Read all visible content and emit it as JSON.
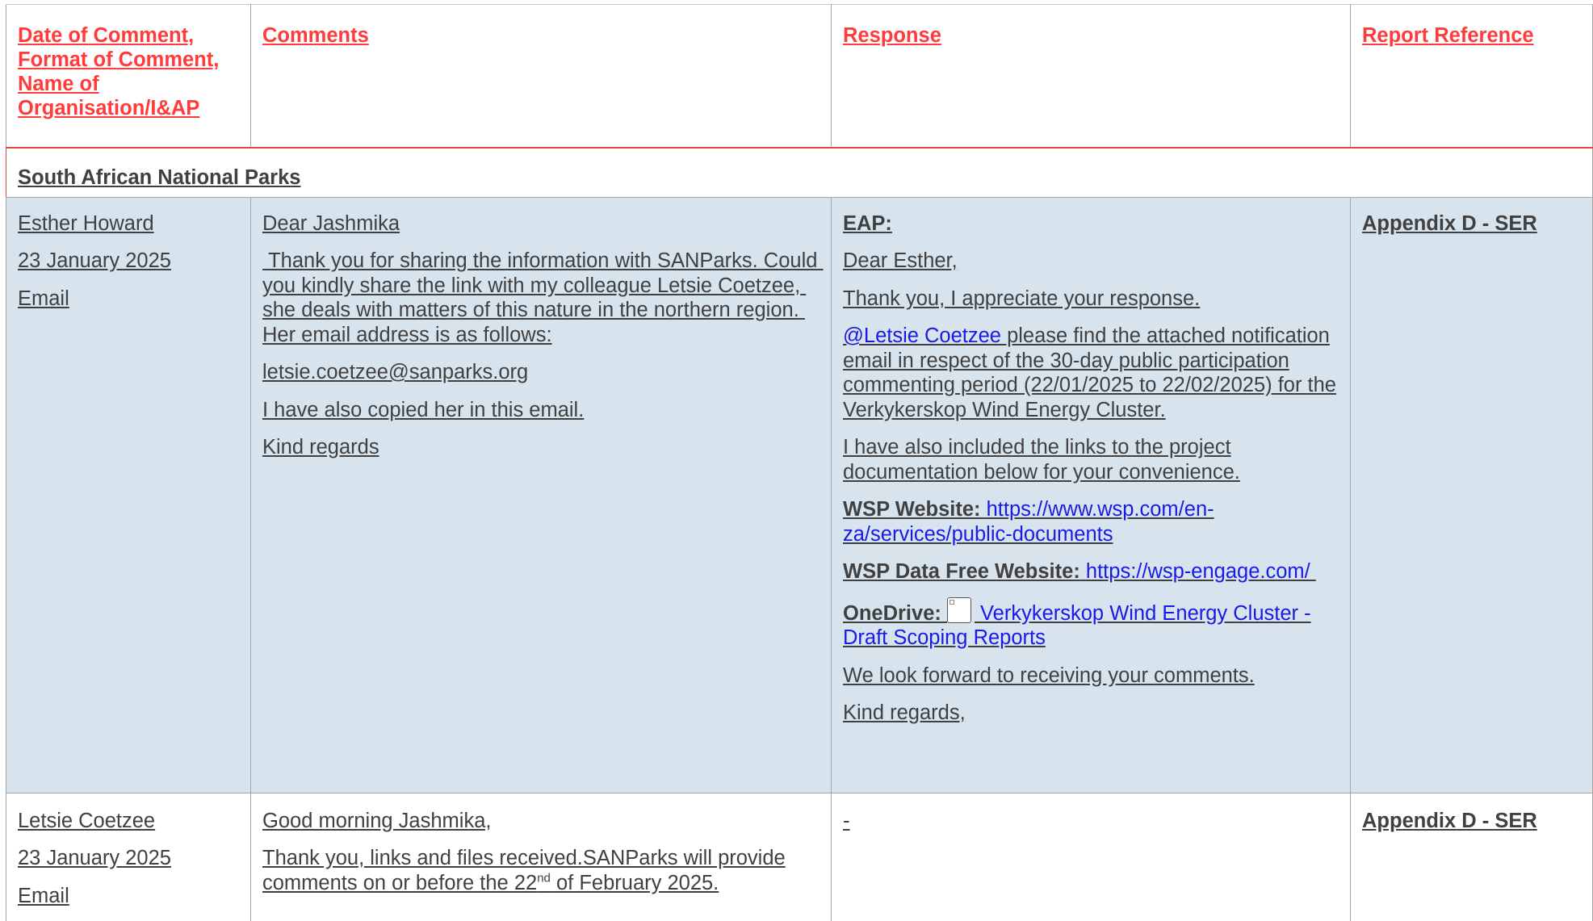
{
  "headers": {
    "col1": "Date of Comment, Format of Comment, Name of Organisation/I&AP",
    "col2": "Comments",
    "col3": "Response",
    "col4": "Report Reference"
  },
  "section_title": "South African National Parks",
  "rows": [
    {
      "name": "Esther Howard",
      "date": "23 January 2025",
      "format": "Email",
      "comments": [
        "Dear Jashmika",
        " Thank you for sharing the information with SANParks. Could you kindly share the link with my colleague Letsie Coetzee, she deals with matters of this nature in the northern region. Her email address is as follows:",
        "letsie.coetzee@sanparks.org",
        "I have also copied her in this email.",
        "Kind regards"
      ],
      "response": {
        "eap_label": "EAP:",
        "greeting": "Dear Esther,",
        "thanks": "Thank you, I appreciate your response.",
        "mention": "@Letsie Coetzee",
        "mention_text": " please find the attached notification email in respect of the 30-day public participation commenting period (22/01/2025 to 22/02/2025) for the Verkykerskop Wind Energy Cluster.",
        "links_intro": "I have also included the links to the project documentation below for your convenience.",
        "wsp_label": "WSP Website:",
        "wsp_url": "https://www.wsp.com/en-za/services/public-documents",
        "wsp_free_label": "WSP Data Free Website:",
        "wsp_free_url": "https://wsp-engage.com/ ",
        "onedrive_label": "OneDrive:",
        "onedrive_link": " Verkykerskop Wind Energy Cluster - Draft Scoping Reports",
        "closing": "We look forward to receiving your comments.",
        "signoff": "Kind regards,"
      },
      "reference": "Appendix D - SER"
    },
    {
      "name": "Letsie Coetzee",
      "date": "23 January 2025",
      "format": "Email",
      "comments_greeting": "Good morning Jashmika,",
      "comments_body_pre": "Thank you, links and files received.SANParks will provide comments on or before the 22",
      "comments_body_sup": "nd",
      "comments_body_post": " of February 2025.",
      "response": "-",
      "reference": "Appendix D - SER"
    }
  ]
}
